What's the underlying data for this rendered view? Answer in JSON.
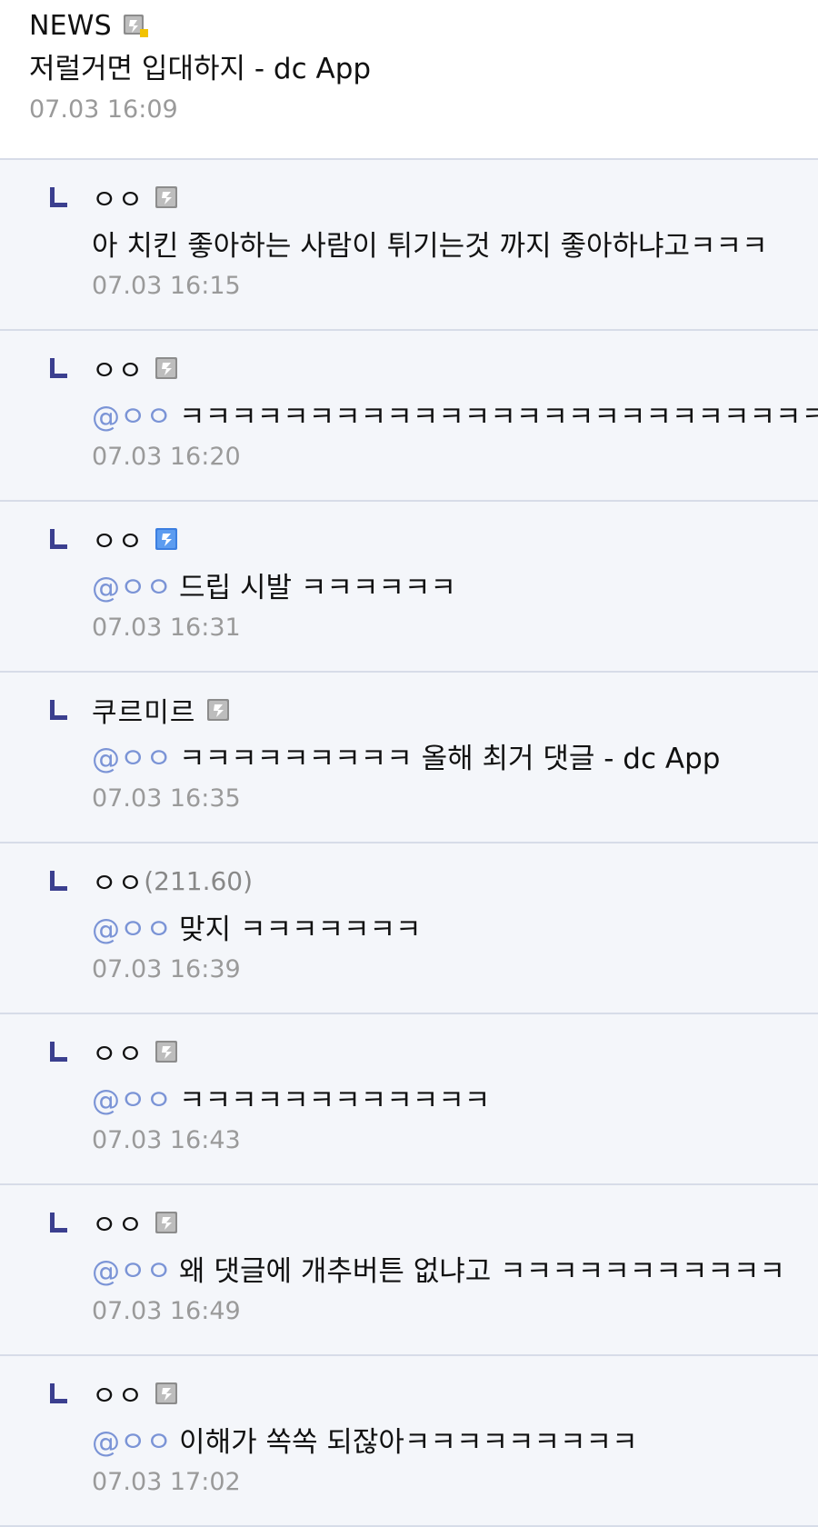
{
  "post": {
    "author": "NEWS",
    "text": "저럴거면 입대하지 - dc App",
    "time": "07.03 16:09"
  },
  "replies": [
    {
      "author": "ㅇㅇ",
      "mention": "",
      "text": "아 치킨 좋아하는 사람이 튀기는것 까지 좋아하냐고ㅋㅋㅋ",
      "time": "07.03 16:15",
      "badge": "gray-gallery-icon"
    },
    {
      "author": "ㅇㅇ",
      "mention": "@ㅇㅇ",
      "text": "ㅋㅋㅋㅋㅋㅋㅋㅋㅋㅋㅋㅋㅋㅋㅋㅋㅋㅋㅋㅋㅋㅋㅋㅋㅋ",
      "time": "07.03 16:20",
      "badge": "gray-gallery-icon"
    },
    {
      "author": "ㅇㅇ",
      "mention": "@ㅇㅇ",
      "text": "드립 시발 ㅋㅋㅋㅋㅋㅋ",
      "time": "07.03 16:31",
      "badge": "blue-gallery-icon"
    },
    {
      "author": "쿠르미르",
      "mention": "@ㅇㅇ",
      "text": "ㅋㅋㅋㅋㅋㅋㅋㅋㅋ 올해 최거 댓글 - dc App",
      "time": "07.03 16:35",
      "badge": "gray-gallery-icon"
    },
    {
      "author": "ㅇㅇ",
      "ip": "(211.60)",
      "mention": "@ㅇㅇ",
      "text": "맞지 ㅋㅋㅋㅋㅋㅋㅋ",
      "time": "07.03 16:39",
      "badge": ""
    },
    {
      "author": "ㅇㅇ",
      "mention": "@ㅇㅇ",
      "text": "ㅋㅋㅋㅋㅋㅋㅋㅋㅋㅋㅋㅋ",
      "time": "07.03 16:43",
      "badge": "gray-gallery-icon"
    },
    {
      "author": "ㅇㅇ",
      "mention": "@ㅇㅇ",
      "text": "왜 댓글에 개추버튼 없냐고 ㅋㅋㅋㅋㅋㅋㅋㅋㅋㅋㅋ",
      "time": "07.03 16:49",
      "badge": "gray-gallery-icon"
    },
    {
      "author": "ㅇㅇ",
      "mention": "@ㅇㅇ",
      "text": "이해가 쏙쏙 되잖아ㅋㅋㅋㅋㅋㅋㅋㅋㅋ",
      "time": "07.03 17:02",
      "badge": "gray-gallery-icon"
    }
  ],
  "colors": {
    "reply_background": "#f4f6fa",
    "mention": "#7b94d6",
    "timestamp": "#9a9a9a",
    "reply_marker": "#3b3f8f",
    "badge_gray": "#8c8c8c",
    "badge_blue": "#3c7fe0",
    "badge_new_dot": "#f2c200"
  },
  "icons": {
    "post_badge": "gallery-new-icon",
    "reply_marker": "reply-arrow-icon"
  }
}
